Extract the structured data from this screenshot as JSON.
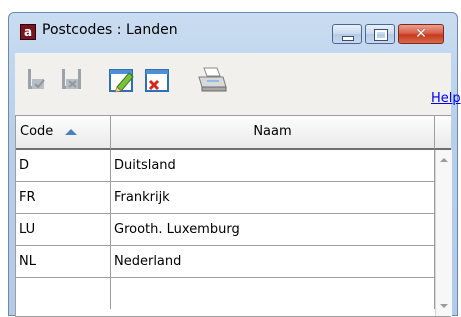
{
  "window": {
    "title": "Postcodes : Landen",
    "app_icon_letter": "a",
    "close_glyph": "✕"
  },
  "toolbar": {
    "items": [
      {
        "name": "save-confirm-icon",
        "enabled": false
      },
      {
        "name": "save-cancel-icon",
        "enabled": false
      },
      {
        "name": "edit-icon",
        "enabled": true
      },
      {
        "name": "delete-icon",
        "enabled": true
      },
      {
        "name": "printer-icon",
        "enabled": true
      }
    ],
    "help_label": "Help"
  },
  "grid": {
    "columns": [
      {
        "label": "Code",
        "sorted": "ascending"
      },
      {
        "label": "Naam"
      }
    ],
    "rows": [
      {
        "code": "D",
        "naam": "Duitsland"
      },
      {
        "code": "FR",
        "naam": "Frankrijk"
      },
      {
        "code": "LU",
        "naam": "Grooth. Luxemburg"
      },
      {
        "code": "NL",
        "naam": "Nederland"
      },
      {
        "code": "",
        "naam": ""
      }
    ]
  },
  "colors": {
    "accent": "#4a7fc0",
    "link": "#0000ee",
    "close_button": "#c6391e"
  }
}
